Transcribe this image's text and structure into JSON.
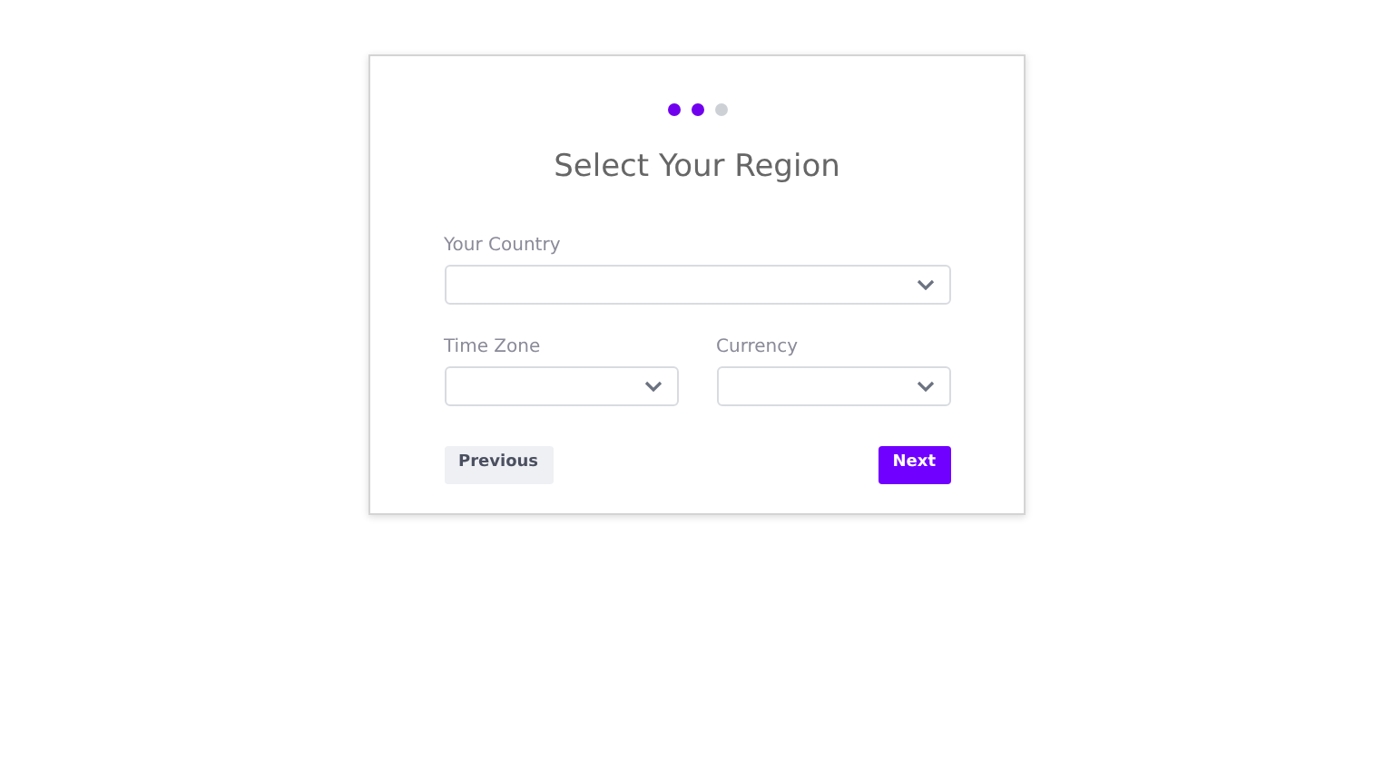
{
  "steps": [
    {
      "done": true
    },
    {
      "done": true
    },
    {
      "done": false
    }
  ],
  "title": "Select Your Region",
  "field_rows": [
    [
      {
        "label": "Your Country"
      }
    ],
    [
      {
        "label": "Time Zone"
      },
      {
        "label": "Currency"
      }
    ]
  ],
  "buttons": {
    "previous": "Previous",
    "next": "Next"
  }
}
